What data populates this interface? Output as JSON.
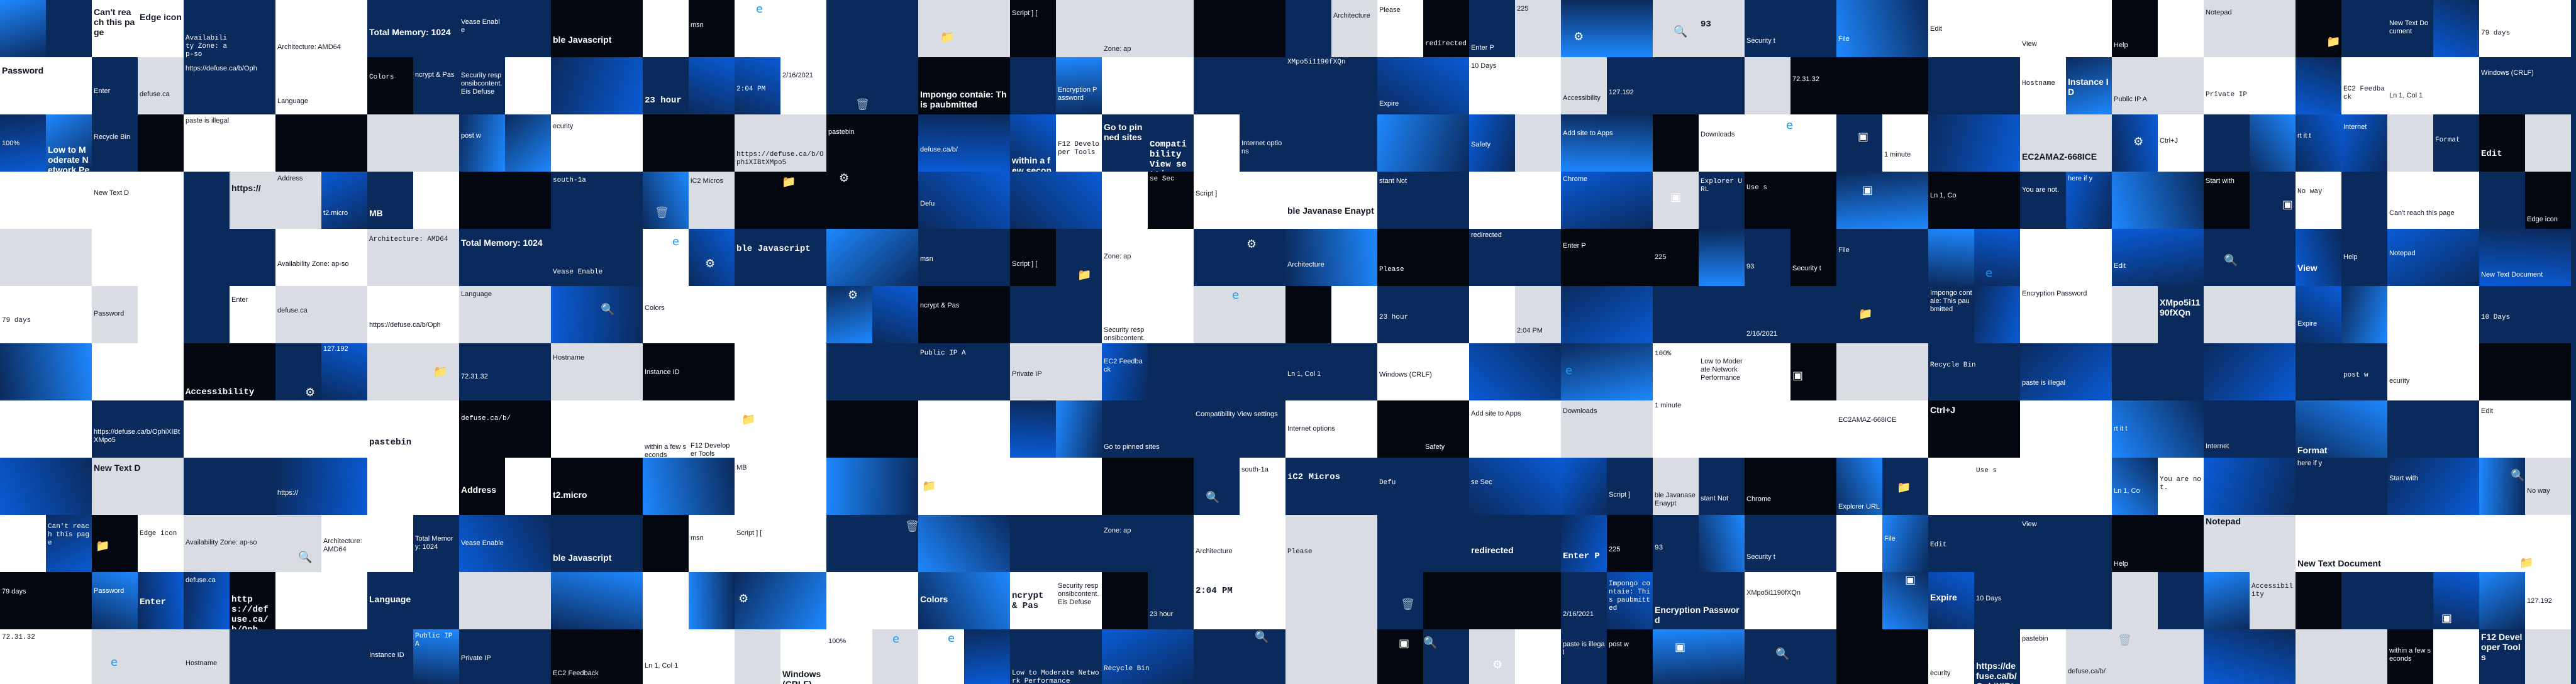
{
  "palette": {
    "blue": "#0a5bd6",
    "bright": "#1e88ff",
    "navy": "#0b2a5c",
    "black": "#03070f",
    "white": "#ffffff",
    "gray": "#d9dde3",
    "dark": "#111827"
  },
  "fragments": [
    "Can't reach this page",
    "Edge icon",
    "Availability Zone: ap-so",
    "Architecture: AMD64",
    "Total Memory: 1024",
    "Vease Enable",
    "ble Javascript",
    "msn",
    "Script ] [",
    "Zone: ap",
    "Architecture",
    "Please",
    "redirected",
    "Enter P",
    "225",
    "93",
    "Security t",
    "File",
    "Edit",
    "View",
    "Help",
    "Notepad",
    "New Text Document",
    "79 days",
    "Password",
    "Enter",
    "defuse.ca",
    "https://defuse.ca/b/Oph",
    "Language",
    "Colors",
    "ncrypt & Pas",
    "Security responsibcontent. Eis Defuse",
    "23 hour",
    "2:04 PM",
    "2/16/2021",
    "Impongo contaie: This paubmitted",
    "Encryption Password",
    "XMpo5i1190fXQn",
    "Expire",
    "10 Days",
    "Accessibility",
    "127.192",
    "72.31.32",
    "Hostname",
    "Instance ID",
    "Public IP A",
    "Private IP",
    "EC2 Feedback",
    "Ln 1, Col 1",
    "Windows (CRLF)",
    "100%",
    "Low to Moderate Network Performance",
    "Recycle Bin",
    "paste is illegal",
    "post w",
    "ecurity",
    "https://defuse.ca/b/OphiXIBtXMpo5",
    "pastebin",
    "defuse.ca/b/",
    "within a few seconds",
    "F12 Developer Tools",
    "Go to pinned sites",
    "Compatibility View settings",
    "Internet options",
    "Safety",
    "Add site to Apps",
    "Downloads",
    "1 minute",
    "EC2AMAZ-668ICE",
    "Ctrl+J",
    "rt it t",
    "Internet",
    "Format",
    "Edit",
    "New Text D",
    "https://",
    "Address",
    "t2.micro",
    "MB",
    "south-1a",
    "iC2 Micros",
    "Defu",
    "se Sec",
    "Script ]",
    "ble Javanase Enaypt",
    "stant Not",
    "Chrome",
    "Explorer URL",
    "Use s",
    "Ln 1, Co",
    "You are not.",
    "here if y",
    "Start with",
    "No way"
  ]
}
